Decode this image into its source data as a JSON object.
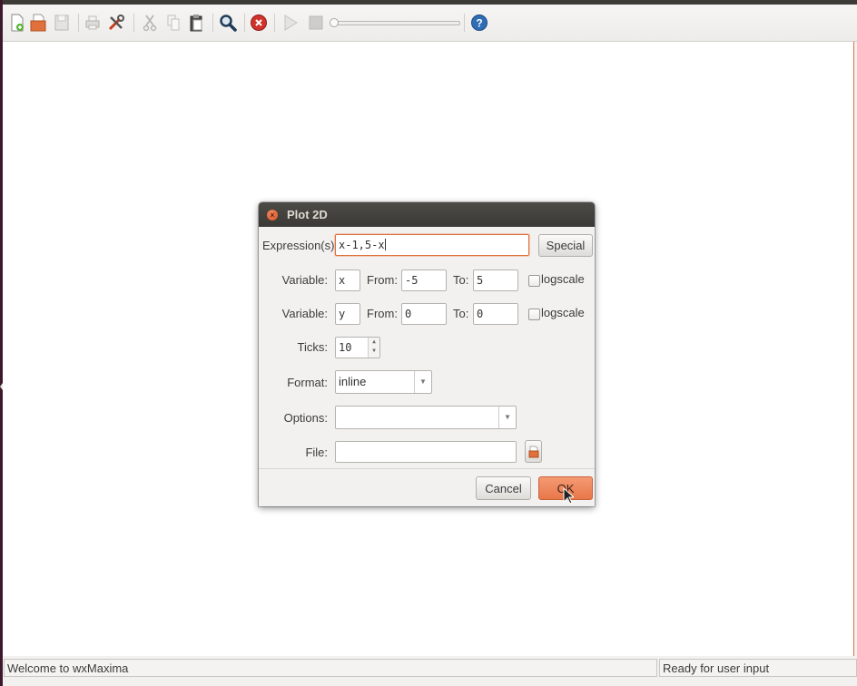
{
  "toolbar": {
    "icons": [
      "new-file-icon",
      "open-file-icon",
      "save-icon",
      "print-icon",
      "preferences-icon",
      "cut-icon",
      "copy-icon",
      "paste-icon",
      "find-icon",
      "interrupt-icon",
      "play-icon",
      "stop-icon",
      "animation-slider",
      "help-icon"
    ]
  },
  "dialog": {
    "title": "Plot 2D",
    "expression_label": "Expression(s):",
    "expression_value": "x-1,5-x",
    "special_button": "Special",
    "variable1": {
      "label": "Variable:",
      "value": "x",
      "from_label": "From:",
      "from_value": "-5",
      "to_label": "To:",
      "to_value": "5",
      "logscale_label": "logscale"
    },
    "variable2": {
      "label": "Variable:",
      "value": "y",
      "from_label": "From:",
      "from_value": "0",
      "to_label": "To:",
      "to_value": "0",
      "logscale_label": "logscale"
    },
    "ticks_label": "Ticks:",
    "ticks_value": "10",
    "format_label": "Format:",
    "format_value": "inline",
    "options_label": "Options:",
    "options_value": "",
    "file_label": "File:",
    "file_value": "",
    "cancel_button": "Cancel",
    "ok_button": "OK"
  },
  "statusbar": {
    "left": "Welcome to wxMaxima",
    "right": "Ready for user input"
  },
  "colors": {
    "accent": "#e0703c",
    "titlebar": "#3c3b37",
    "desktop": "#3c1a2b"
  }
}
